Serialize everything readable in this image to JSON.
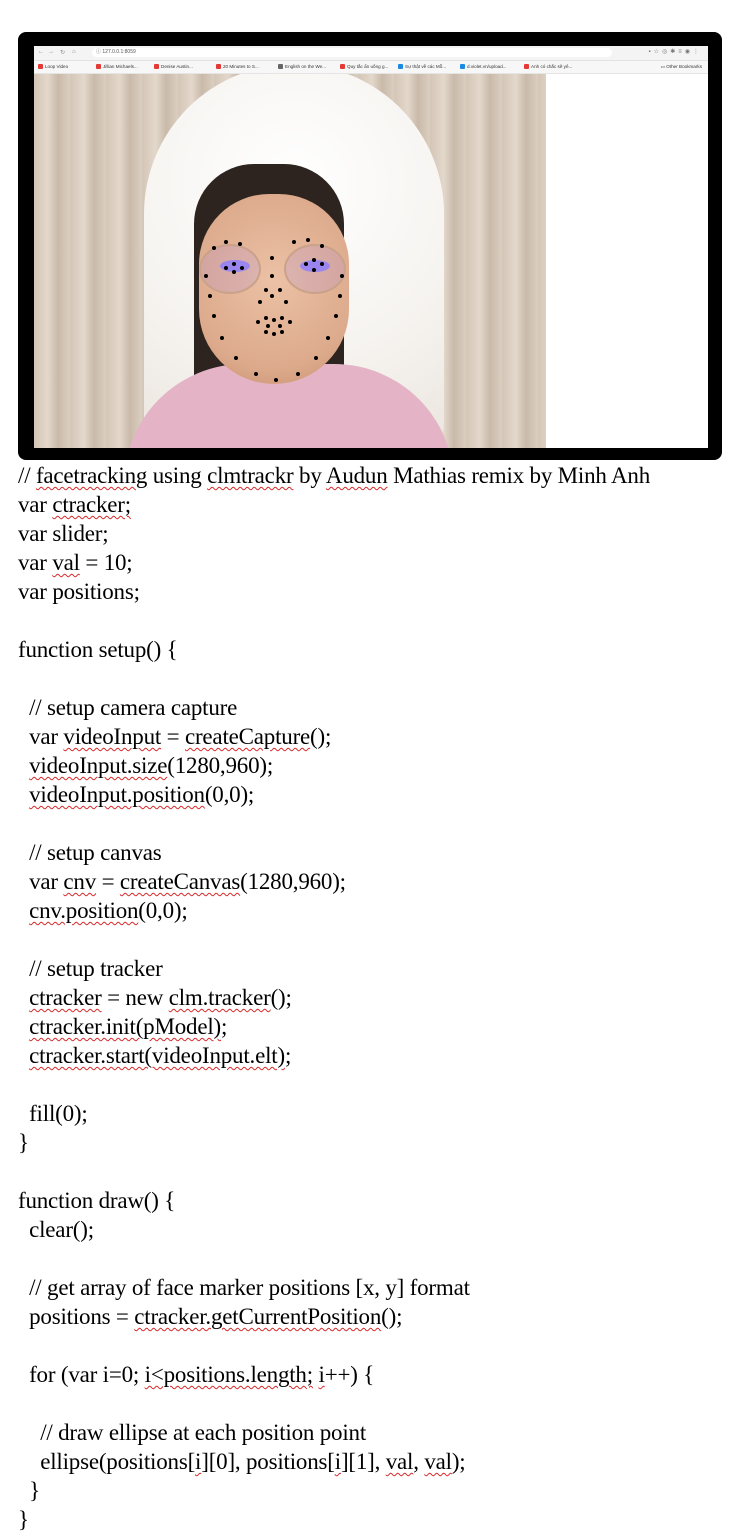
{
  "browser": {
    "url": "127.0.0.1:8059",
    "nav_icons": [
      "back-icon",
      "forward-icon",
      "reload-icon",
      "home-icon"
    ],
    "bookmarks": [
      {
        "label": "Loop Video",
        "color": "#e53935"
      },
      {
        "label": "Jillian Michaels...",
        "color": "#e53935"
      },
      {
        "label": "Denise Austin...",
        "color": "#e53935"
      },
      {
        "label": "20 Minutes to S...",
        "color": "#e53935"
      },
      {
        "label": "English on the We...",
        "color": "#666666"
      },
      {
        "label": "Quy tắc ẩn uống g...",
        "color": "#e53935"
      },
      {
        "label": "Sự thật về các Mỗ...",
        "color": "#1e88e5"
      },
      {
        "label": "d.violet.vn/upload...",
        "color": "#1e88e5"
      },
      {
        "label": "Anh có chắc sẽ yê...",
        "color": "#e53935"
      }
    ],
    "other_bookmarks": "Other Bookmarks"
  },
  "code": {
    "lines": [
      [
        {
          "t": "// "
        },
        {
          "t": "facetracking",
          "sq": true
        },
        {
          "t": " using "
        },
        {
          "t": "clmtrackr",
          "sq": true
        },
        {
          "t": " by "
        },
        {
          "t": "Audun",
          "sq": true
        },
        {
          "t": " Mathias remix by Minh Anh"
        }
      ],
      [
        {
          "t": "var "
        },
        {
          "t": "ctracker;",
          "sq": true
        }
      ],
      [
        {
          "t": "var slider;"
        }
      ],
      [
        {
          "t": "var "
        },
        {
          "t": "val",
          "sq": true
        },
        {
          "t": " = 10;"
        }
      ],
      [
        {
          "t": "var positions;"
        }
      ],
      [],
      [
        {
          "t": "function setup() {"
        }
      ],
      [],
      [
        {
          "t": "  // setup camera capture"
        }
      ],
      [
        {
          "t": "  var "
        },
        {
          "t": "videoInput",
          "sq": true
        },
        {
          "t": " = "
        },
        {
          "t": "createCapture",
          "sq": true
        },
        {
          "t": "();"
        }
      ],
      [
        {
          "t": "  "
        },
        {
          "t": "videoInput.size",
          "sq": true
        },
        {
          "t": "(1280,960);"
        }
      ],
      [
        {
          "t": "  "
        },
        {
          "t": "videoInput.position",
          "sq": true
        },
        {
          "t": "(0,0);"
        }
      ],
      [],
      [
        {
          "t": "  // setup canvas"
        }
      ],
      [
        {
          "t": "  var "
        },
        {
          "t": "cnv",
          "sq": true
        },
        {
          "t": " = "
        },
        {
          "t": "createCanvas",
          "sq": true
        },
        {
          "t": "(1280,960);"
        }
      ],
      [
        {
          "t": "  "
        },
        {
          "t": "cnv.position",
          "sq": true
        },
        {
          "t": "(0,0);"
        }
      ],
      [],
      [
        {
          "t": "  // setup tracker"
        }
      ],
      [
        {
          "t": "  "
        },
        {
          "t": "ctracker",
          "sq": true
        },
        {
          "t": " = new "
        },
        {
          "t": "clm.tracker",
          "sq": true
        },
        {
          "t": "();"
        }
      ],
      [
        {
          "t": "  "
        },
        {
          "t": "ctracker.init(pModel)",
          "sq": true
        },
        {
          "t": ";"
        }
      ],
      [
        {
          "t": "  "
        },
        {
          "t": "ctracker.start(videoInput.elt)",
          "sq": true
        },
        {
          "t": ";"
        }
      ],
      [],
      [
        {
          "t": "  fill(0);"
        }
      ],
      [
        {
          "t": "}"
        }
      ],
      [],
      [
        {
          "t": "function draw() {"
        }
      ],
      [
        {
          "t": "  clear();"
        }
      ],
      [],
      [
        {
          "t": "  // get array of face marker positions [x, y] format"
        }
      ],
      [
        {
          "t": "  positions = "
        },
        {
          "t": "ctracker.getCurrentPosition",
          "sq": true
        },
        {
          "t": "();"
        }
      ],
      [],
      [
        {
          "t": "  for (var i=0; "
        },
        {
          "t": "i<positions.length;",
          "sq": true
        },
        {
          "t": " "
        },
        {
          "t": "i",
          "sq": true
        },
        {
          "t": "++) {"
        }
      ],
      [],
      [
        {
          "t": "    // draw ellipse at each position point"
        }
      ],
      [
        {
          "t": "    ellipse(positions["
        },
        {
          "t": "i",
          "sq": true
        },
        {
          "t": "][0], positions["
        },
        {
          "t": "i",
          "sq": true
        },
        {
          "t": "][1], "
        },
        {
          "t": "val",
          "sq": true
        },
        {
          "t": ", "
        },
        {
          "t": "val",
          "sq": true
        },
        {
          "t": ");"
        }
      ],
      [
        {
          "t": "  }"
        }
      ],
      [
        {
          "t": "}"
        }
      ]
    ]
  }
}
